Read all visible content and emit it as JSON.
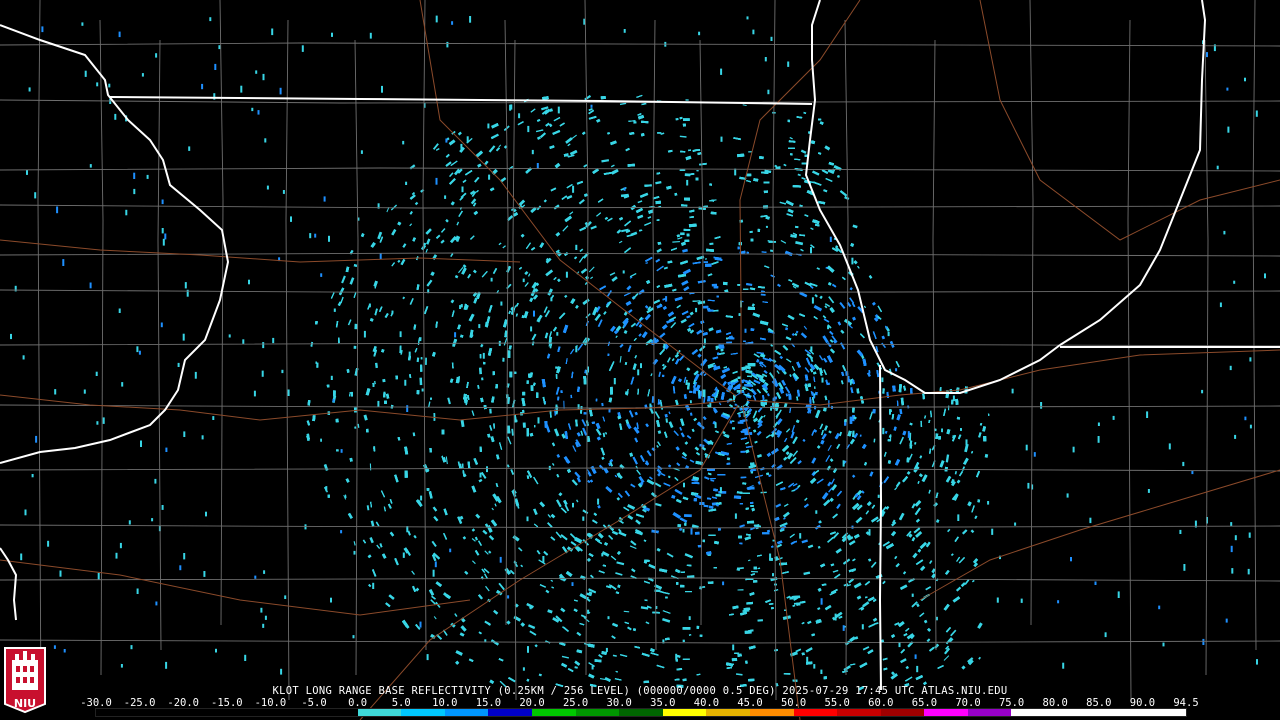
{
  "product_caption": "KLOT LONG RANGE BASE REFLECTIVITY (0.25KM / 256 LEVEL) (000000/0000 0.5 DEG) 2025-07-29 17:45 UTC  ATLAS.NIU.EDU",
  "radar_site": "KLOT",
  "timestamp": "2025-07-29 17:45 UTC",
  "logo_text": "NIU",
  "colorbar": {
    "labels": [
      "-30.0",
      "-25.0",
      "-20.0",
      "-15.0",
      "-10.0",
      "-5.0",
      "0.0",
      "5.0",
      "10.0",
      "15.0",
      "20.0",
      "25.0",
      "30.0",
      "35.0",
      "40.0",
      "45.0",
      "50.0",
      "55.0",
      "60.0",
      "65.0",
      "70.0",
      "75.0",
      "80.0",
      "85.0",
      "90.0",
      "94.5"
    ],
    "values": [
      -30,
      -25,
      -20,
      -15,
      -10,
      -5,
      0,
      5,
      10,
      15,
      20,
      25,
      30,
      35,
      40,
      45,
      50,
      55,
      60,
      65,
      70,
      75,
      80,
      85,
      90,
      94.5
    ],
    "colors": [
      "#000000",
      "#000000",
      "#000000",
      "#000000",
      "#000000",
      "#000000",
      "#3fd9d9",
      "#00c8ff",
      "#0096ff",
      "#0000c8",
      "#00c800",
      "#009600",
      "#006400",
      "#ffff00",
      "#e6b400",
      "#ff8c00",
      "#ff0000",
      "#c80000",
      "#a00000",
      "#ff00ff",
      "#9600c8",
      "#ffffff",
      "#ffffff",
      "#ffffff",
      "#ffffff"
    ]
  },
  "map_colors": {
    "background": "#000000",
    "state_borders": "#ffffff",
    "county_lines": "#7a7a7a",
    "highways": "#8b4a2a",
    "echo_light": "#38d6e6",
    "echo_mid": "#1e90ff",
    "radar_site_marker": "#000000"
  }
}
